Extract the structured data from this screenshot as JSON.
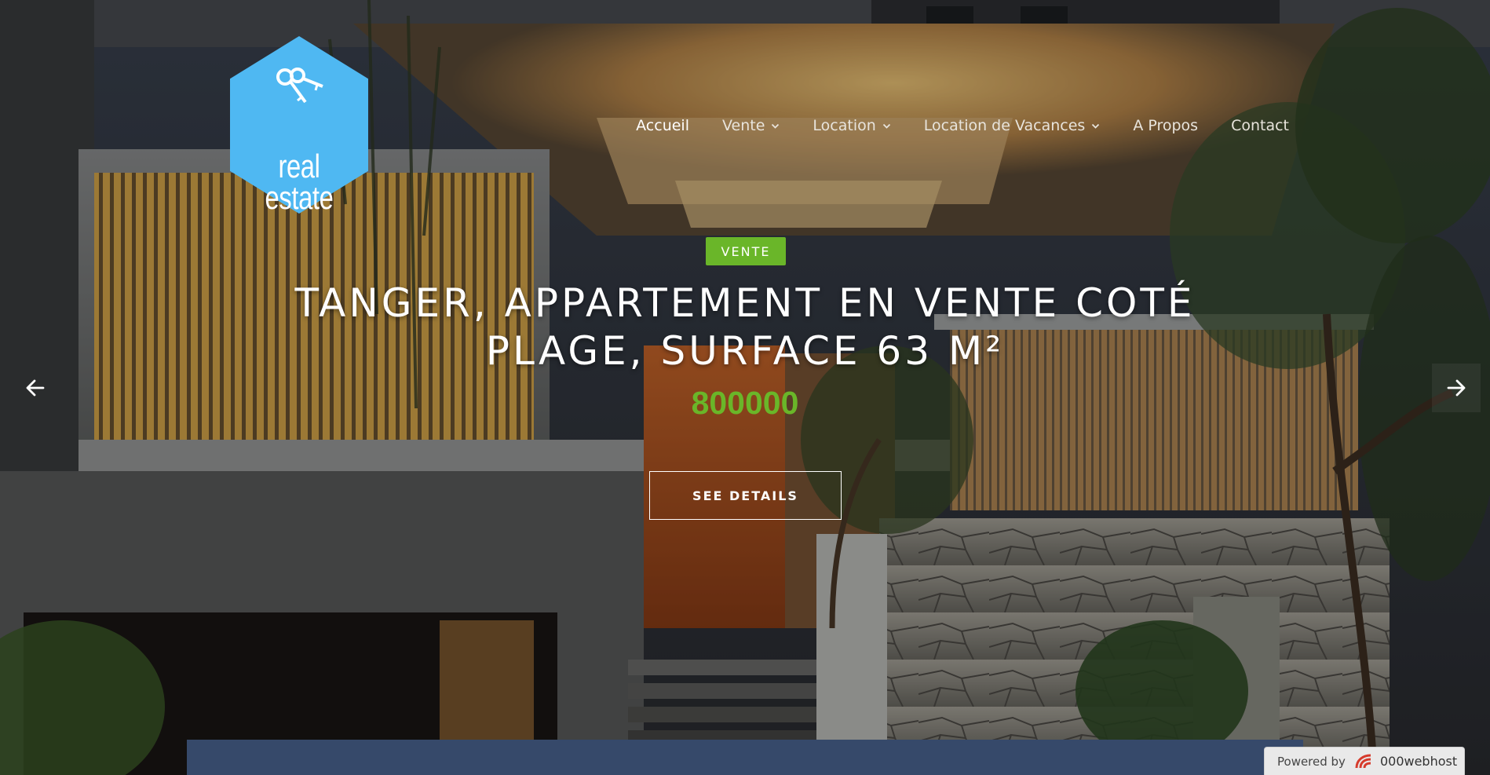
{
  "brand": {
    "logo_line1": "real",
    "logo_line2": "estate",
    "logo_color": "#4fb8f2"
  },
  "nav": {
    "items": [
      {
        "label": "Accueil",
        "active": true,
        "dropdown": false
      },
      {
        "label": "Vente",
        "active": false,
        "dropdown": true
      },
      {
        "label": "Location",
        "active": false,
        "dropdown": true
      },
      {
        "label": "Location de Vacances",
        "active": false,
        "dropdown": true
      },
      {
        "label": "A Propos",
        "active": false,
        "dropdown": false
      },
      {
        "label": "Contact",
        "active": false,
        "dropdown": false
      }
    ]
  },
  "slide": {
    "badge": "VENTE",
    "title_line1": "TANGER, APPARTEMENT EN VENTE COTÉ",
    "title_line2": "PLAGE, SURFACE 63 M²",
    "price": "800000",
    "button": "SEE DETAILS",
    "badge_color": "#6ab629"
  },
  "controls": {
    "prev_icon": "arrow-left-icon",
    "next_icon": "arrow-right-icon"
  },
  "footer": {
    "powered_by": "Powered by",
    "host": "000webhost"
  }
}
